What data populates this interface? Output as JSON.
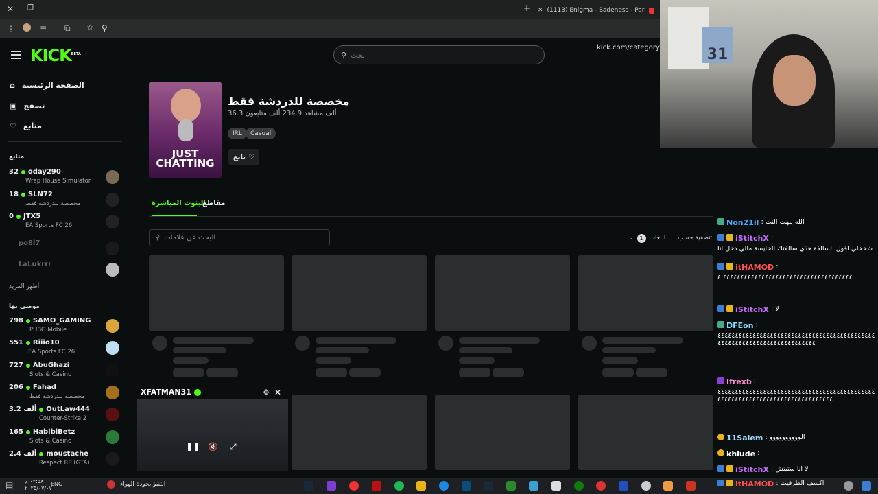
{
  "browser": {
    "tab_title": "(1113) Enigma - Sadeness - Par",
    "url": "kick.com/category/just"
  },
  "kick": {
    "logo": "KICK",
    "logo_beta": "BETA",
    "search_placeholder": "بحث"
  },
  "sidebar": {
    "nav": [
      {
        "label": "الصفحة الرئيسية",
        "icon": "home-icon"
      },
      {
        "label": "تصفح",
        "icon": "browse-icon"
      },
      {
        "label": "متابع",
        "icon": "heart-icon"
      }
    ],
    "following_title": "متابع",
    "following": [
      {
        "viewers": "32",
        "name": "oday290",
        "game": "Wrap House Simulator",
        "live": true
      },
      {
        "viewers": "18",
        "name": "SLN72",
        "game": "مخصصة للدردشة فقط",
        "live": true
      },
      {
        "viewers": "0",
        "name": "JTX5",
        "game": "EA Sports FC 26",
        "live": true
      },
      {
        "viewers": "",
        "name": "po8l7",
        "game": "",
        "live": false
      },
      {
        "viewers": "",
        "name": "LaLukrrr",
        "game": "",
        "live": false
      }
    ],
    "show_more": "أظهر المزيد",
    "recommended_title": "موصى بها",
    "recommended": [
      {
        "viewers": "798",
        "name": "SAMO_GAMING",
        "game": "PUBG Mobile"
      },
      {
        "viewers": "551",
        "name": "Riiio10",
        "game": "EA Sports FC 26"
      },
      {
        "viewers": "727",
        "name": "AbuGhazi",
        "game": "Slots & Casino"
      },
      {
        "viewers": "206",
        "name": "Fahad",
        "game": "مخصصة للدردشة فقط"
      },
      {
        "viewers": "3.2 ألف",
        "name": "OutLaw444",
        "game": "Counter-Strike 2"
      },
      {
        "viewers": "165",
        "name": "HabibiBetz",
        "game": "Slots & Casino"
      },
      {
        "viewers": "2.4 ألف",
        "name": "moustache",
        "game": "Respect RP (GTA)"
      }
    ]
  },
  "category": {
    "cover_text": "JUST CHATTING",
    "title": "مخصصة للدردشة فقط",
    "stats": "36.3 ألف مشاهد 234.9 ألف متابعون",
    "tags": [
      "IRL",
      "Casual"
    ],
    "follow_label": "تابع",
    "tabs": [
      "البثوث المباشرة",
      "مقاطع"
    ],
    "filter_placeholder": "البحث عن علامات",
    "sort_label": "تصفية حسب:",
    "sort_value": "اللغات",
    "sort_badge": "1"
  },
  "pip": {
    "channel": "XFATMAN31"
  },
  "webcam": {
    "poster_number": "31"
  },
  "chat": [
    {
      "user": "Non21il",
      "color": "#4aa8ff",
      "text": "الله يبهت النت"
    },
    {
      "user": "iStitchX",
      "color": "#c86bff",
      "text": "شخخلي اقول السالفة هذي سالفتك الخايسة مالي دخل انا"
    },
    {
      "user": "itHAMOD",
      "color": "#ff4d4d",
      "text": "٤٤٤٤٤٤٤٤٤٤٤٤٤٤٤٤٤٤٤٤٤٤٤٤٤٤٤٤٤٤٤٤٤٤٤٤٤ ٤"
    },
    {
      "user": "iStitchX",
      "color": "#c86bff",
      "text": "لا"
    },
    {
      "user": "DFEon",
      "color": "#7de1ff",
      "text": "٤٤٤٤٤٤٤٤٤٤٤٤٤٤٤٤٤٤٤٤٤٤٤٤٤٤٤٤٤٤٤٤٤٤٤٤٤٤٤٤٤٤٤٤٤٤٤٤٤٤٤٤٤٤٤٤٤٤٤٤٤٤٤٤٤٤٤٤٤٤٤٤٤"
    },
    {
      "user": "Ifrexb",
      "color": "#ff8fd0",
      "text": "٤٤٤٤٤٤٤٤٤٤٤٤٤٤٤٤٤٤٤٤٤٤٤٤٤٤٤٤٤٤٤٤٤٤٤٤٤٤٤٤٤٤٤٤٤٤٤٤٤٤٤٤٤٤٤٤٤٤٤٤٤٤٤٤٤٤٤٤٤٤٤٤٤٤٤٤٤٤"
    },
    {
      "user": "11Salem",
      "color": "#9fd9ff",
      "text": "الوووووووووو"
    },
    {
      "user": "khlude",
      "color": "#ffffff",
      "text": ""
    },
    {
      "user": "iStitchX",
      "color": "#c86bff",
      "text": "لا انا ستيتش"
    },
    {
      "user": "itHAMOD",
      "color": "#ff4d4d",
      "text": "اكشف الطرقيت"
    }
  ],
  "taskbar": {
    "lang": "ENG",
    "time": "٠٣:٥٨ م",
    "date": "٢٠٢٥/٠٧/٠٧",
    "weather": "التنبؤ بجودة الهواء"
  },
  "colors": {
    "accent": "#53fc18",
    "bg": "#0b0e0f",
    "skeleton": "#2b2e2f"
  }
}
